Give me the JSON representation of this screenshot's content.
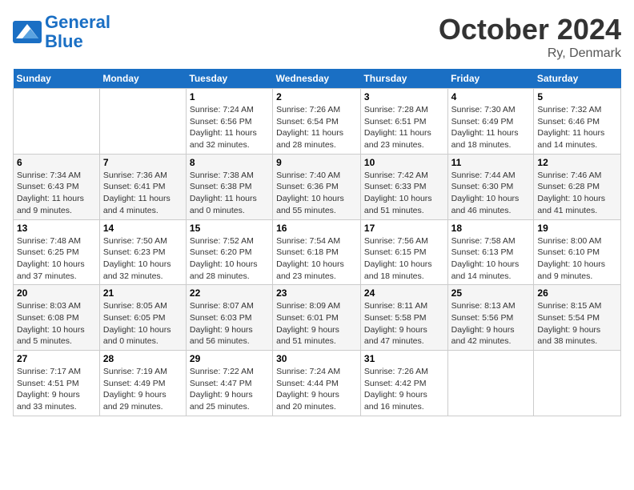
{
  "header": {
    "logo_line1": "General",
    "logo_line2": "Blue",
    "month_title": "October 2024",
    "location": "Ry, Denmark"
  },
  "weekdays": [
    "Sunday",
    "Monday",
    "Tuesday",
    "Wednesday",
    "Thursday",
    "Friday",
    "Saturday"
  ],
  "weeks": [
    [
      {
        "day": "",
        "info": ""
      },
      {
        "day": "",
        "info": ""
      },
      {
        "day": "1",
        "info": "Sunrise: 7:24 AM\nSunset: 6:56 PM\nDaylight: 11 hours\nand 32 minutes."
      },
      {
        "day": "2",
        "info": "Sunrise: 7:26 AM\nSunset: 6:54 PM\nDaylight: 11 hours\nand 28 minutes."
      },
      {
        "day": "3",
        "info": "Sunrise: 7:28 AM\nSunset: 6:51 PM\nDaylight: 11 hours\nand 23 minutes."
      },
      {
        "day": "4",
        "info": "Sunrise: 7:30 AM\nSunset: 6:49 PM\nDaylight: 11 hours\nand 18 minutes."
      },
      {
        "day": "5",
        "info": "Sunrise: 7:32 AM\nSunset: 6:46 PM\nDaylight: 11 hours\nand 14 minutes."
      }
    ],
    [
      {
        "day": "6",
        "info": "Sunrise: 7:34 AM\nSunset: 6:43 PM\nDaylight: 11 hours\nand 9 minutes."
      },
      {
        "day": "7",
        "info": "Sunrise: 7:36 AM\nSunset: 6:41 PM\nDaylight: 11 hours\nand 4 minutes."
      },
      {
        "day": "8",
        "info": "Sunrise: 7:38 AM\nSunset: 6:38 PM\nDaylight: 11 hours\nand 0 minutes."
      },
      {
        "day": "9",
        "info": "Sunrise: 7:40 AM\nSunset: 6:36 PM\nDaylight: 10 hours\nand 55 minutes."
      },
      {
        "day": "10",
        "info": "Sunrise: 7:42 AM\nSunset: 6:33 PM\nDaylight: 10 hours\nand 51 minutes."
      },
      {
        "day": "11",
        "info": "Sunrise: 7:44 AM\nSunset: 6:30 PM\nDaylight: 10 hours\nand 46 minutes."
      },
      {
        "day": "12",
        "info": "Sunrise: 7:46 AM\nSunset: 6:28 PM\nDaylight: 10 hours\nand 41 minutes."
      }
    ],
    [
      {
        "day": "13",
        "info": "Sunrise: 7:48 AM\nSunset: 6:25 PM\nDaylight: 10 hours\nand 37 minutes."
      },
      {
        "day": "14",
        "info": "Sunrise: 7:50 AM\nSunset: 6:23 PM\nDaylight: 10 hours\nand 32 minutes."
      },
      {
        "day": "15",
        "info": "Sunrise: 7:52 AM\nSunset: 6:20 PM\nDaylight: 10 hours\nand 28 minutes."
      },
      {
        "day": "16",
        "info": "Sunrise: 7:54 AM\nSunset: 6:18 PM\nDaylight: 10 hours\nand 23 minutes."
      },
      {
        "day": "17",
        "info": "Sunrise: 7:56 AM\nSunset: 6:15 PM\nDaylight: 10 hours\nand 18 minutes."
      },
      {
        "day": "18",
        "info": "Sunrise: 7:58 AM\nSunset: 6:13 PM\nDaylight: 10 hours\nand 14 minutes."
      },
      {
        "day": "19",
        "info": "Sunrise: 8:00 AM\nSunset: 6:10 PM\nDaylight: 10 hours\nand 9 minutes."
      }
    ],
    [
      {
        "day": "20",
        "info": "Sunrise: 8:03 AM\nSunset: 6:08 PM\nDaylight: 10 hours\nand 5 minutes."
      },
      {
        "day": "21",
        "info": "Sunrise: 8:05 AM\nSunset: 6:05 PM\nDaylight: 10 hours\nand 0 minutes."
      },
      {
        "day": "22",
        "info": "Sunrise: 8:07 AM\nSunset: 6:03 PM\nDaylight: 9 hours\nand 56 minutes."
      },
      {
        "day": "23",
        "info": "Sunrise: 8:09 AM\nSunset: 6:01 PM\nDaylight: 9 hours\nand 51 minutes."
      },
      {
        "day": "24",
        "info": "Sunrise: 8:11 AM\nSunset: 5:58 PM\nDaylight: 9 hours\nand 47 minutes."
      },
      {
        "day": "25",
        "info": "Sunrise: 8:13 AM\nSunset: 5:56 PM\nDaylight: 9 hours\nand 42 minutes."
      },
      {
        "day": "26",
        "info": "Sunrise: 8:15 AM\nSunset: 5:54 PM\nDaylight: 9 hours\nand 38 minutes."
      }
    ],
    [
      {
        "day": "27",
        "info": "Sunrise: 7:17 AM\nSunset: 4:51 PM\nDaylight: 9 hours\nand 33 minutes."
      },
      {
        "day": "28",
        "info": "Sunrise: 7:19 AM\nSunset: 4:49 PM\nDaylight: 9 hours\nand 29 minutes."
      },
      {
        "day": "29",
        "info": "Sunrise: 7:22 AM\nSunset: 4:47 PM\nDaylight: 9 hours\nand 25 minutes."
      },
      {
        "day": "30",
        "info": "Sunrise: 7:24 AM\nSunset: 4:44 PM\nDaylight: 9 hours\nand 20 minutes."
      },
      {
        "day": "31",
        "info": "Sunrise: 7:26 AM\nSunset: 4:42 PM\nDaylight: 9 hours\nand 16 minutes."
      },
      {
        "day": "",
        "info": ""
      },
      {
        "day": "",
        "info": ""
      }
    ]
  ]
}
